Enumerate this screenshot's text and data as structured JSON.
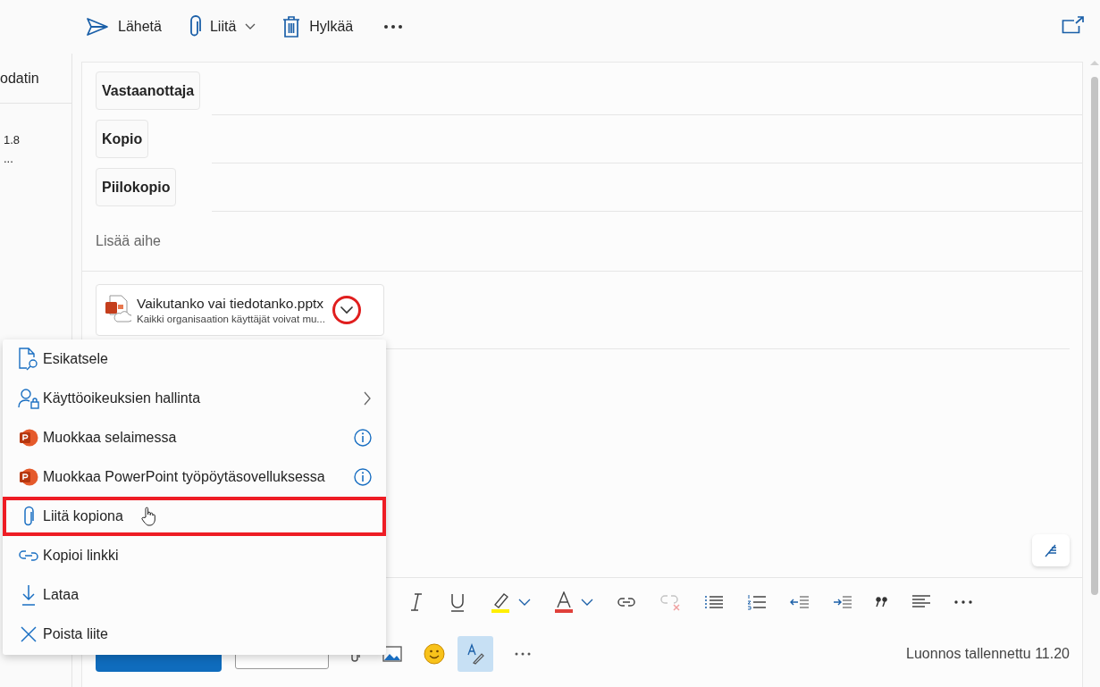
{
  "command_bar": {
    "actions": [
      {
        "kind": "send",
        "label": "Lähetä"
      },
      {
        "kind": "attach",
        "label": "Liitä",
        "dropdown": true
      },
      {
        "kind": "discard",
        "label": "Hylkää"
      }
    ]
  },
  "left_pane": {
    "heading": "odatin",
    "items": [
      "1.8",
      "..."
    ]
  },
  "compose": {
    "recipient_fields": [
      "Vastaanottaja",
      "Kopio",
      "Piilokopio"
    ],
    "subject": {
      "placeholder": "Lisää aihe"
    },
    "attachment": {
      "name": "Vaikutanko vai tiedotanko.pptx",
      "sharing": "Kaikki organisaation käyttäjät voivat mu...",
      "menu_button_circled": true
    },
    "format_toolbar": {
      "unlink_disabled": true
    },
    "bottom_bar": {
      "editor_selected": true,
      "status": "Luonnos tallennettu 11.20"
    }
  },
  "attachment_menu": [
    {
      "label": "Esikatsele",
      "kind": "plain",
      "highlighted": false
    },
    {
      "label": "Käyttöoikeuksien hallinta",
      "kind": "submenu",
      "highlighted": false
    },
    {
      "label": "Muokkaa selaimessa",
      "kind": "info",
      "highlighted": false
    },
    {
      "label": "Muokkaa PowerPoint työpöytäsovelluksessa",
      "kind": "info",
      "highlighted": false
    },
    {
      "label": "Liitä kopiona",
      "kind": "plain",
      "highlighted": true
    },
    {
      "label": "Kopioi linkki",
      "kind": "plain",
      "highlighted": false
    },
    {
      "label": "Lataa",
      "kind": "plain",
      "highlighted": false
    },
    {
      "label": "Poista liite",
      "kind": "plain",
      "highlighted": false
    }
  ]
}
